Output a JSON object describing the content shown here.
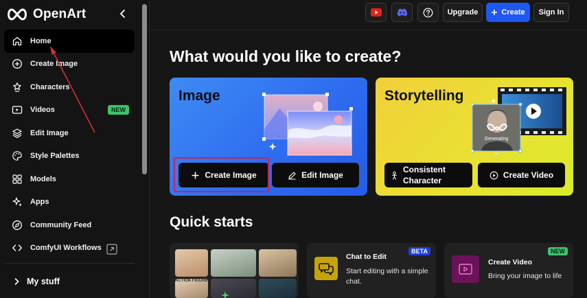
{
  "brand": {
    "name": "OpenArt"
  },
  "sidebar": {
    "items": [
      {
        "label": "Home",
        "icon": "home-icon"
      },
      {
        "label": "Create Image",
        "icon": "plus-circle-icon"
      },
      {
        "label": "Characters",
        "icon": "characters-icon"
      },
      {
        "label": "Videos",
        "icon": "video-icon",
        "badge": "NEW"
      },
      {
        "label": "Edit Image",
        "icon": "layers-icon"
      },
      {
        "label": "Style Palettes",
        "icon": "palette-icon"
      },
      {
        "label": "Models",
        "icon": "grid-icon"
      },
      {
        "label": "Apps",
        "icon": "sparkle-icon"
      },
      {
        "label": "Community Feed",
        "icon": "compass-icon"
      },
      {
        "label": "ComfyUI Workflows",
        "icon": "workflow-icon"
      }
    ],
    "my_stuff": "My stuff"
  },
  "topbar": {
    "upgrade": "Upgrade",
    "create": "Create",
    "sign_in": "Sign In"
  },
  "main": {
    "headline": "What would you like to create?",
    "cards": {
      "image": {
        "title": "Image",
        "create_button": "Create Image",
        "edit_button": "Edit Image"
      },
      "story": {
        "title": "Storytelling",
        "character_button": "Consistent Character",
        "video_button": "Create Video",
        "generating": "Generating"
      }
    },
    "quick_starts": {
      "title": "Quick starts",
      "items": [
        {
          "thumb_text": "ACTION FIGURE"
        },
        {
          "title": "Chat to Edit",
          "description": "Start editing with a simple chat.",
          "badge": "BETA"
        },
        {
          "title": "Create Video",
          "description": "Bring your image to life",
          "badge": "NEW"
        }
      ]
    }
  },
  "colors": {
    "accent": "#1f57f2",
    "new_badge": "#3ec46d",
    "beta_badge": "#1f3fd8",
    "highlight": "#c32657"
  }
}
